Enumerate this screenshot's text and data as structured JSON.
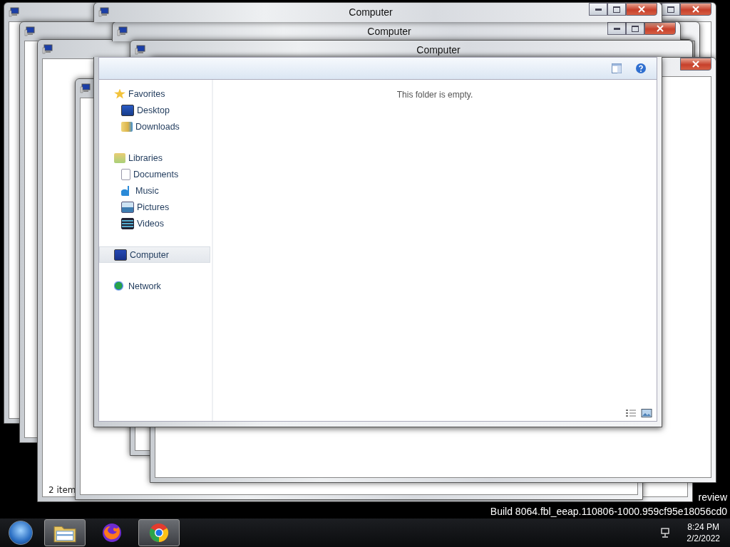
{
  "windows": [
    {
      "kind": "titlebar",
      "title": "Computer"
    },
    {
      "kind": "background"
    },
    {
      "kind": "titlebar",
      "title": "Computer"
    },
    {
      "kind": "background"
    },
    {
      "kind": "background",
      "title": "Computer"
    },
    {
      "kind": "background",
      "status": "2 item"
    },
    {
      "kind": "background"
    },
    {
      "kind": "background"
    }
  ],
  "explorer": {
    "nav": [
      {
        "label": "Favorites",
        "kind": "star",
        "selected": false,
        "children": [
          {
            "label": "Desktop",
            "kind": "desktop",
            "selected": false
          },
          {
            "label": "Downloads",
            "kind": "downloads",
            "selected": false
          }
        ]
      },
      {
        "label": "Libraries",
        "kind": "libraries",
        "selected": false,
        "children": [
          {
            "label": "Documents",
            "kind": "document",
            "selected": false
          },
          {
            "label": "Music",
            "kind": "music",
            "selected": false
          },
          {
            "label": "Pictures",
            "kind": "pictures",
            "selected": false
          },
          {
            "label": "Videos",
            "kind": "videos",
            "selected": false
          }
        ]
      },
      {
        "label": "Computer",
        "kind": "computer",
        "selected": true
      },
      {
        "label": "Network",
        "kind": "network",
        "selected": false
      }
    ],
    "empty_message": "This folder is empty."
  },
  "watermark": [
    "review",
    "Build 8064.fbl_eeap.110806-1000.959cf95e18056cd0"
  ],
  "taskbar": {
    "buttons": [
      {
        "kind": "start"
      },
      {
        "kind": "explorer",
        "running": true
      },
      {
        "kind": "firefox",
        "running": false
      },
      {
        "kind": "chrome",
        "running": true
      }
    ],
    "clock": {
      "time": "8:24 PM",
      "date": "2/2/2022"
    }
  }
}
